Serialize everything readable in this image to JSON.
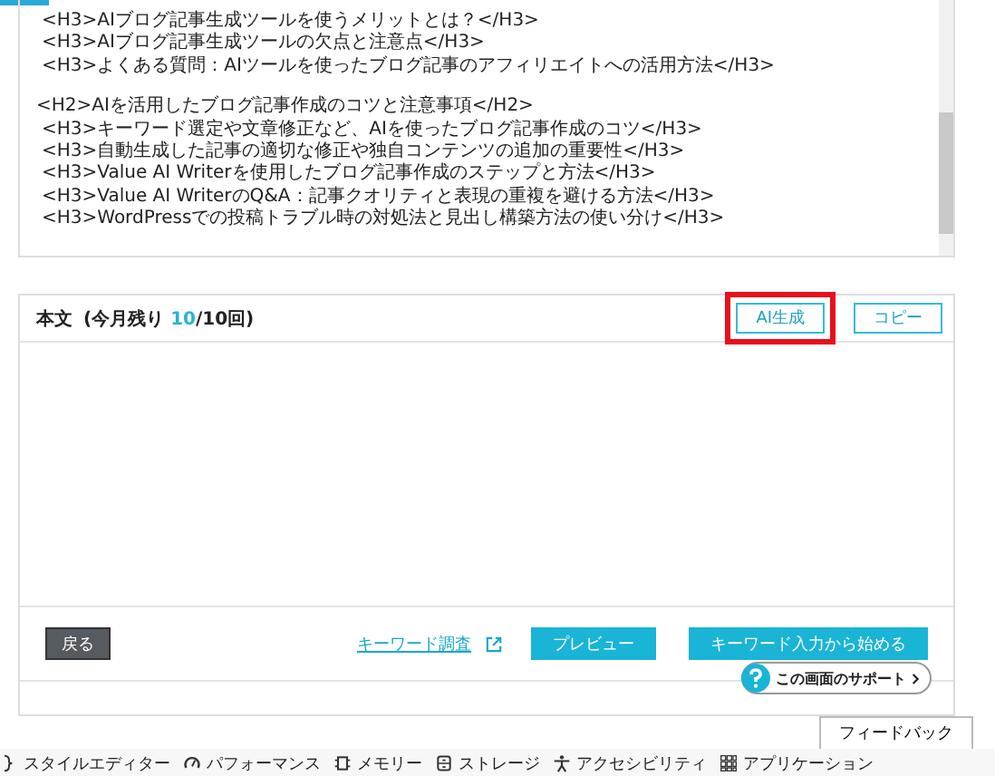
{
  "outline": {
    "lines": [
      {
        "kind": "h3",
        "text": "<H3>AIブログ記事生成ツールを使うメリットとは？</H3>"
      },
      {
        "kind": "h3",
        "text": "<H3>AIブログ記事生成ツールの欠点と注意点</H3>"
      },
      {
        "kind": "h3",
        "text": "<H3>よくある質問：AIツールを使ったブログ記事のアフィリエイトへの活用方法</H3>"
      },
      {
        "kind": "h2",
        "text": "<H2>AIを活用したブログ記事作成のコツと注意事項</H2>"
      },
      {
        "kind": "h3",
        "text": "<H3>キーワード選定や文章修正など、AIを使ったブログ記事作成のコツ</H3>"
      },
      {
        "kind": "h3",
        "text": "<H3>自動生成した記事の適切な修正や独自コンテンツの追加の重要性</H3>"
      },
      {
        "kind": "h3",
        "text": "<H3>Value AI Writerを使用したブログ記事作成のステップと方法</H3>"
      },
      {
        "kind": "h3",
        "text": "<H3>Value AI WriterのQ&A：記事クオリティと表現の重複を避ける方法</H3>"
      },
      {
        "kind": "h3",
        "text": "<H3>WordPressでの投稿トラブル時の対処法と見出し構築方法の使い分け</H3>"
      }
    ]
  },
  "body": {
    "title": "本文",
    "quota_prefix": "(今月残り",
    "quota_remaining": "10",
    "quota_suffix": "/10回)",
    "buttons": [
      {
        "label": "AI生成",
        "highlighted": true
      },
      {
        "label": "コピー",
        "highlighted": false
      }
    ]
  },
  "footer": {
    "back": "戻る",
    "keyword_link": "キーワード調査",
    "preview": "プレビュー",
    "start": "キーワード入力から始める"
  },
  "support": "この画面のサポート",
  "feedback": "フィードバック",
  "devtools": [
    {
      "kind": "style",
      "label": "スタイルエディター"
    },
    {
      "kind": "performance",
      "label": "パフォーマンス"
    },
    {
      "kind": "memory",
      "label": "メモリー"
    },
    {
      "kind": "storage",
      "label": "ストレージ"
    },
    {
      "kind": "accessibility",
      "label": "アクセシビリティ"
    },
    {
      "kind": "application",
      "label": "アプリケーション"
    }
  ]
}
